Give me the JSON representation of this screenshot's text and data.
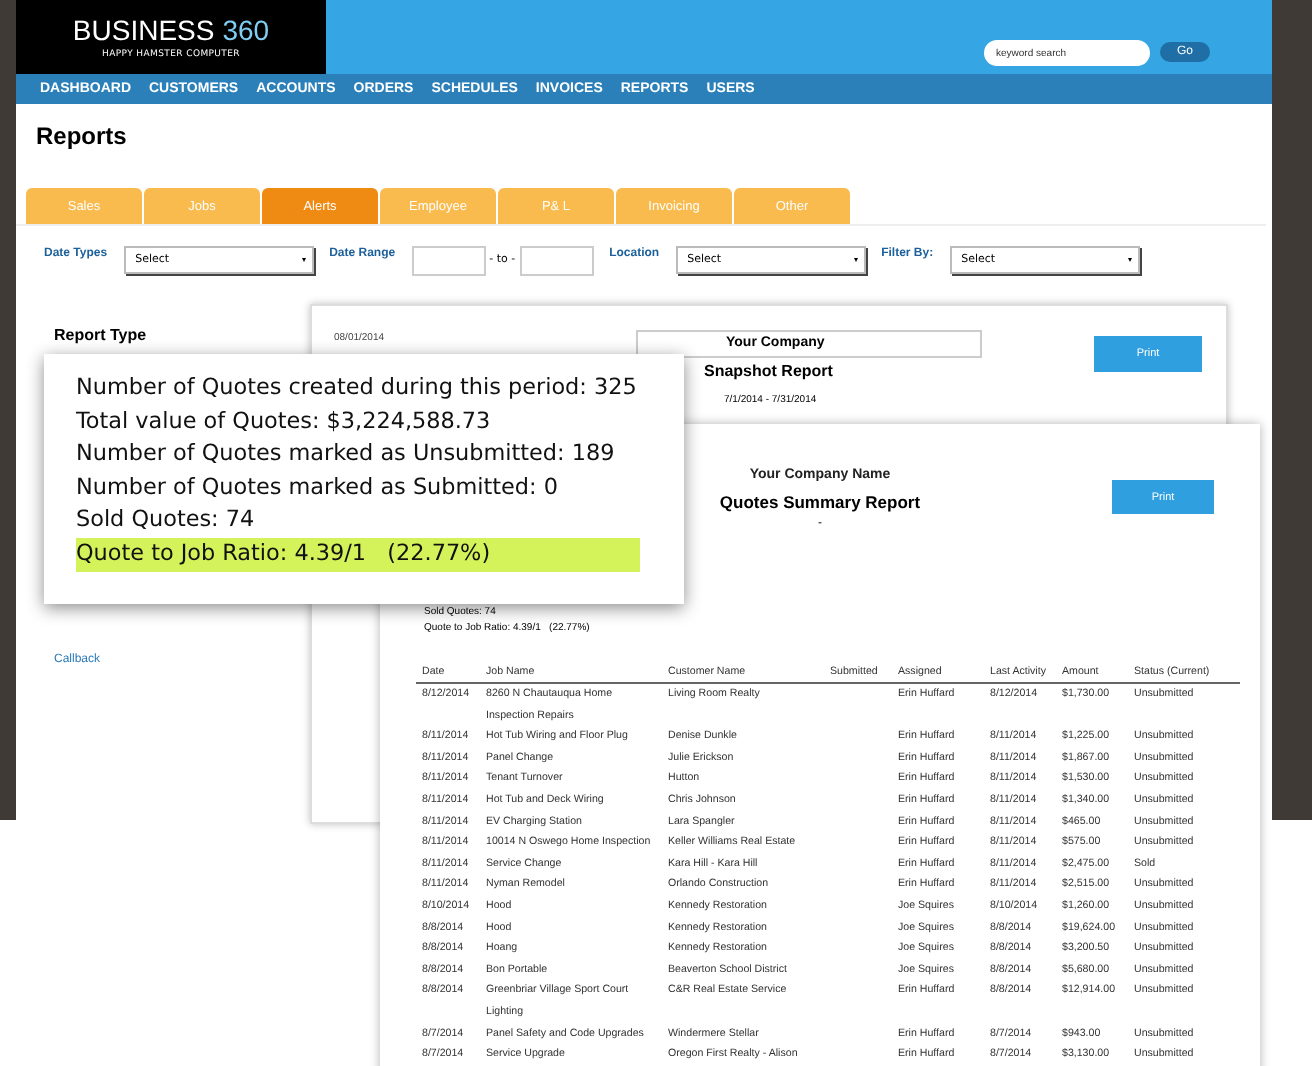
{
  "header": {
    "logo_word": "BUSINESS",
    "logo_number": "360",
    "tagline": "HAPPY HAMSTER COMPUTER",
    "search": {
      "placeholder": "keyword search"
    },
    "search_button": "Go"
  },
  "nav": [
    "DASHBOARD",
    "CUSTOMERS",
    "ACCOUNTS",
    "ORDERS",
    "SCHEDULES",
    "INVOICES",
    "REPORTS",
    "USERS"
  ],
  "page_title": "Reports",
  "tabs": [
    {
      "label": "Sales",
      "selected": false
    },
    {
      "label": "Jobs",
      "selected": false
    },
    {
      "label": "Alerts",
      "selected": true
    },
    {
      "label": "Employee",
      "selected": false
    },
    {
      "label": "P& L",
      "selected": false
    },
    {
      "label": "Invoicing",
      "selected": false
    },
    {
      "label": "Other",
      "selected": false
    }
  ],
  "filters": [
    {
      "label": "Date Types",
      "kind": "select",
      "value": "Select"
    },
    {
      "label": "Date Range",
      "kind": "range",
      "separator": "- to -"
    },
    {
      "label": "Location",
      "kind": "select",
      "value": "Select"
    },
    {
      "label": "Filter By:",
      "kind": "select",
      "value": "Select"
    }
  ],
  "sidebar": {
    "heading": "Report Type",
    "links": [
      "Callback"
    ]
  },
  "snapshot": {
    "date": "08/01/2014",
    "company": "Your Company",
    "title": "Snapshot Report",
    "period": "7/1/2014 - 7/31/2014",
    "print": "Print"
  },
  "quotes_report": {
    "company": "Your Company Name",
    "title": "Quotes Summary Report",
    "subtitle": "-",
    "print": "Print",
    "summary": [
      "Sold Quotes: 74",
      "Quote to Job Ratio: 4.39/1   (22.77%)"
    ],
    "columns": [
      "Date",
      "Job Name",
      "Customer Name",
      "Submitted",
      "Assigned",
      "Last Activity",
      "Amount",
      "Status (Current)"
    ],
    "rows": [
      {
        "date": "8/12/2014",
        "job": "8260 N Chautauqua Home Inspection Repairs",
        "customer": "Living Room Realty",
        "assigned": "Erin Huffard",
        "last_activity": "8/12/2014",
        "amount": "$1,730.00",
        "status": "Unsubmitted"
      },
      {
        "date": "8/11/2014",
        "job": "Hot Tub Wiring and Floor Plug",
        "customer": "Denise Dunkle",
        "assigned": "Erin Huffard",
        "last_activity": "8/11/2014",
        "amount": "$1,225.00",
        "status": "Unsubmitted"
      },
      {
        "date": "8/11/2014",
        "job": "Panel Change",
        "customer": "Julie Erickson",
        "assigned": "Erin Huffard",
        "last_activity": "8/11/2014",
        "amount": "$1,867.00",
        "status": "Unsubmitted"
      },
      {
        "date": "8/11/2014",
        "job": "Tenant Turnover",
        "customer": "Hutton",
        "assigned": "Erin Huffard",
        "last_activity": "8/11/2014",
        "amount": "$1,530.00",
        "status": "Unsubmitted"
      },
      {
        "date": "8/11/2014",
        "job": "Hot Tub and Deck Wiring",
        "customer": "Chris Johnson",
        "assigned": "Erin Huffard",
        "last_activity": "8/11/2014",
        "amount": "$1,340.00",
        "status": "Unsubmitted"
      },
      {
        "date": "8/11/2014",
        "job": "EV Charging Station",
        "customer": "Lara Spangler",
        "assigned": "Erin Huffard",
        "last_activity": "8/11/2014",
        "amount": "$465.00",
        "status": "Unsubmitted"
      },
      {
        "date": "8/11/2014",
        "job": "10014 N Oswego Home Inspection",
        "customer": "Keller Williams Real Estate",
        "assigned": "Erin Huffard",
        "last_activity": "8/11/2014",
        "amount": "$575.00",
        "status": "Unsubmitted"
      },
      {
        "date": "8/11/2014",
        "job": "Service Change",
        "customer": "Kara Hill - Kara Hill",
        "assigned": "Erin Huffard",
        "last_activity": "8/11/2014",
        "amount": "$2,475.00",
        "status": "Sold"
      },
      {
        "date": "8/11/2014",
        "job": "Nyman Remodel",
        "customer": "Orlando Construction",
        "assigned": "Erin Huffard",
        "last_activity": "8/11/2014",
        "amount": "$2,515.00",
        "status": "Unsubmitted"
      },
      {
        "date": "8/10/2014",
        "job": "Hood",
        "customer": "Kennedy Restoration",
        "assigned": "Joe Squires",
        "last_activity": "8/10/2014",
        "amount": "$1,260.00",
        "status": "Unsubmitted"
      },
      {
        "date": "8/8/2014",
        "job": "Hood",
        "customer": "Kennedy Restoration",
        "assigned": "Joe Squires",
        "last_activity": "8/8/2014",
        "amount": "$19,624.00",
        "status": "Unsubmitted"
      },
      {
        "date": "8/8/2014",
        "job": "Hoang",
        "customer": "Kennedy Restoration",
        "assigned": "Joe Squires",
        "last_activity": "8/8/2014",
        "amount": "$3,200.50",
        "status": "Unsubmitted"
      },
      {
        "date": "8/8/2014",
        "job": "Bon Portable",
        "customer": "Beaverton School District",
        "assigned": "Joe Squires",
        "last_activity": "8/8/2014",
        "amount": "$5,680.00",
        "status": "Unsubmitted"
      },
      {
        "date": "8/8/2014",
        "job": "Greenbriar Village Sport Court Lighting",
        "customer": "C&R Real Estate Service",
        "assigned": "Erin Huffard",
        "last_activity": "8/8/2014",
        "amount": "$12,914.00",
        "status": "Unsubmitted"
      },
      {
        "date": "8/7/2014",
        "job": "Panel Safety and Code Upgrades",
        "customer": "Windermere Stellar",
        "assigned": "Erin Huffard",
        "last_activity": "8/7/2014",
        "amount": "$943.00",
        "status": "Unsubmitted"
      },
      {
        "date": "8/7/2014",
        "job": "Service Upgrade",
        "customer": "Oregon First Realty - Alison",
        "assigned": "Erin Huffard",
        "last_activity": "8/7/2014",
        "amount": "$3,130.00",
        "status": "Unsubmitted"
      }
    ]
  },
  "callout": {
    "lines": [
      {
        "text": "Number of Quotes created during this period: 325",
        "highlighted": false
      },
      {
        "text": "Total value of Quotes: $3,224,588.73",
        "highlighted": false
      },
      {
        "text": "Number of Quotes marked as Unsubmitted: 189",
        "highlighted": false
      },
      {
        "text": "Number of Quotes marked as Submitted: 0",
        "highlighted": false
      },
      {
        "text": "Sold Quotes: 74",
        "highlighted": false
      },
      {
        "text": "Quote to Job Ratio: 4.39/1   (22.77%)",
        "highlighted": true
      }
    ]
  }
}
